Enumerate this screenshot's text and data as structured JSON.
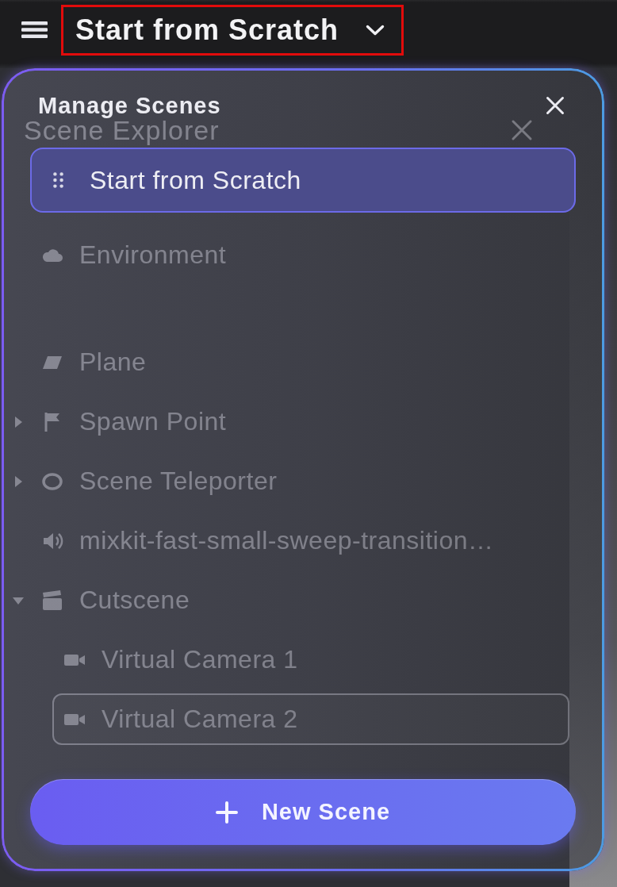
{
  "top_bar": {
    "title": "Start from Scratch",
    "highlighted": true
  },
  "scene_explorer": {
    "title": "Scene Explorer",
    "sections": [
      {
        "items": [
          {
            "label": "Environment",
            "kind": "environment",
            "selected": false
          }
        ]
      },
      {
        "items": [
          {
            "label": "Plane",
            "kind": "plane",
            "selected": false
          },
          {
            "label": "Spawn Point",
            "kind": "spawn-point",
            "expanded": false,
            "selected": false
          },
          {
            "label": "Scene Teleporter",
            "kind": "teleporter",
            "expanded": false,
            "selected": false
          },
          {
            "label": "mixkit-fast-small-sweep-transition…",
            "kind": "audio",
            "selected": false
          },
          {
            "label": "Cutscene",
            "kind": "cutscene",
            "expanded": true,
            "selected": false,
            "children": [
              {
                "label": "Virtual Camera 1",
                "kind": "camera",
                "selected": false
              },
              {
                "label": "Virtual Camera 2",
                "kind": "camera",
                "selected": true
              }
            ]
          }
        ]
      }
    ]
  },
  "manage_scenes": {
    "title": "Manage Scenes",
    "scenes": [
      {
        "label": "Start from Scratch",
        "selected": true
      }
    ],
    "new_scene_button": "New Scene"
  }
}
